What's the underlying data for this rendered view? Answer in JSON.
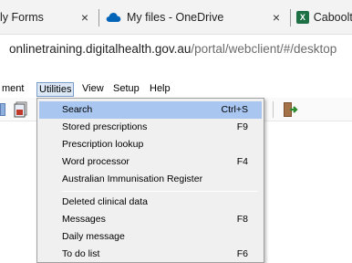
{
  "browser": {
    "tabs": [
      {
        "title": "ly Forms"
      },
      {
        "title": "My files - OneDrive",
        "icon": "onedrive-icon"
      },
      {
        "title": "Caboolt",
        "icon": "excel-icon",
        "icon_text": "X"
      }
    ],
    "close_glyph": "×",
    "url_host": "onlinetraining.digitalhealth.gov.au",
    "url_path": "/portal/webclient/#/desktop"
  },
  "menubar": {
    "items": [
      {
        "label": "ment"
      },
      {
        "label": "Utilities",
        "active": true
      },
      {
        "label": "View"
      },
      {
        "label": "Setup"
      },
      {
        "label": "Help"
      }
    ]
  },
  "utilities_menu": {
    "items": [
      {
        "label": "Search",
        "shortcut": "Ctrl+S",
        "highlighted": true
      },
      {
        "label": "Stored prescriptions",
        "shortcut": "F9"
      },
      {
        "label": "Prescription lookup",
        "shortcut": ""
      },
      {
        "label": "Word processor",
        "shortcut": "F4"
      },
      {
        "label": "Australian Immunisation Register",
        "shortcut": ""
      },
      {
        "label": "Deleted clinical data",
        "shortcut": ""
      },
      {
        "label": "Messages",
        "shortcut": "F8"
      },
      {
        "label": "Daily message",
        "shortcut": ""
      },
      {
        "label": "To do list",
        "shortcut": "F6"
      }
    ]
  },
  "colors": {
    "highlight": "#a8c6ef",
    "onedrive_blue": "#0364b8",
    "excel_green": "#1e7145"
  }
}
